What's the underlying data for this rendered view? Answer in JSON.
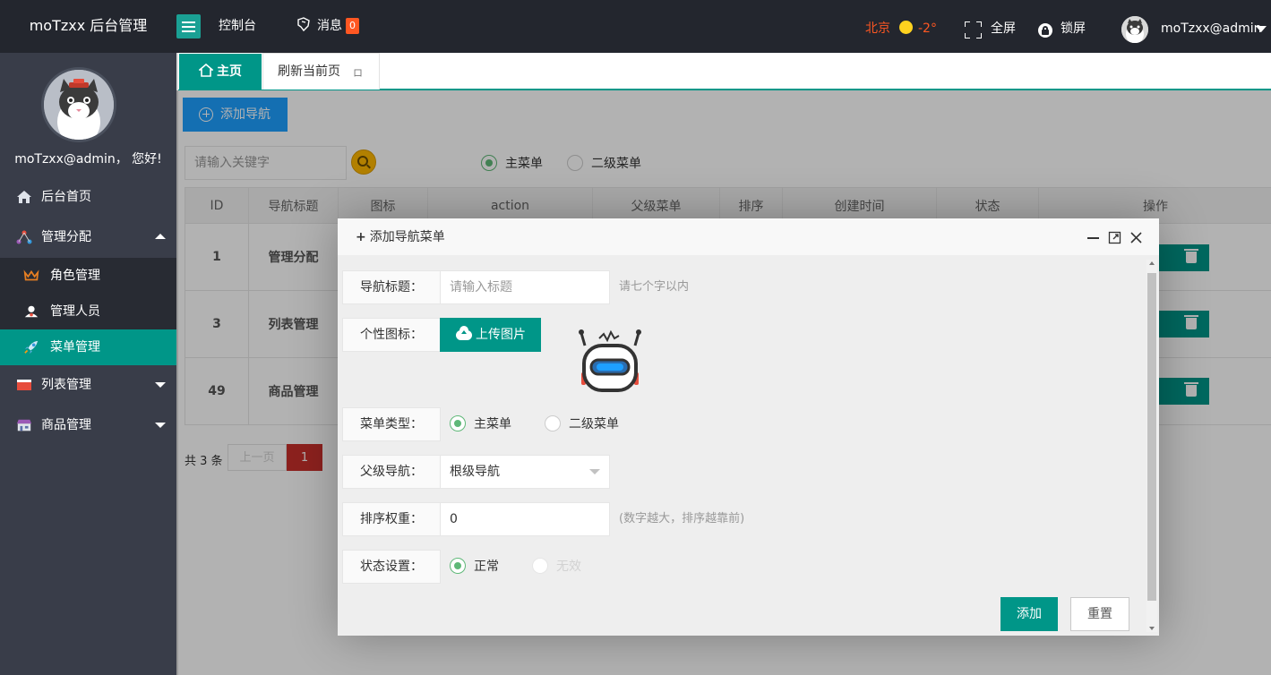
{
  "header": {
    "logo": "moTzxx 后台管理",
    "nav_dashboard": "控制台",
    "nav_messages": "消息",
    "message_count": "0",
    "city": "北京",
    "temperature": "-2°",
    "fullscreen": "全屏",
    "lock": "锁屏",
    "user": "moTzxx@admin"
  },
  "sidebar": {
    "greeting": "moTzxx@admin， 您好!",
    "items": [
      {
        "label": "后台首页"
      },
      {
        "label": "管理分配"
      },
      {
        "label": "角色管理"
      },
      {
        "label": "管理人员"
      },
      {
        "label": "菜单管理"
      },
      {
        "label": "列表管理"
      },
      {
        "label": "商品管理"
      }
    ]
  },
  "tabs": {
    "home": "主页",
    "refresh": "刷新当前页",
    "close": "ロ"
  },
  "toolbar": {
    "add_nav": "添加导航",
    "search_placeholder": "请输入关键字",
    "filter_main": "主菜单",
    "filter_sub": "二级菜单"
  },
  "table": {
    "headers": [
      "ID",
      "导航标题",
      "图标",
      "action",
      "父级菜单",
      "排序",
      "创建时间",
      "状态",
      "操作"
    ],
    "rows": [
      {
        "id": "1",
        "title": "管理分配"
      },
      {
        "id": "3",
        "title": "列表管理"
      },
      {
        "id": "49",
        "title": "商品管理"
      }
    ]
  },
  "pagination": {
    "total": "共 3 条",
    "prev": "上一页",
    "current": "1"
  },
  "modal": {
    "title": "添加导航菜单",
    "nav_title_label": "导航标题：",
    "nav_title_placeholder": "请输入标题",
    "nav_title_hint": "请七个字以内",
    "icon_label": "个性图标：",
    "upload_label": "上传图片",
    "menu_type_label": "菜单类型：",
    "menu_type_main": "主菜单",
    "menu_type_sub": "二级菜单",
    "parent_label": "父级导航：",
    "parent_value": "根级导航",
    "sort_label": "排序权重：",
    "sort_value": "0",
    "sort_hint": "(数字越大，排序越靠前)",
    "status_label": "状态设置：",
    "status_normal": "正常",
    "status_invalid": "无效",
    "submit": "添加",
    "reset": "重置"
  },
  "colors": {
    "header_bg": "#23262e",
    "sidebar_bg": "#393d49",
    "accent": "#009688",
    "blue": "#1e9fff",
    "danger": "#ff5722",
    "weather": "#ff5722"
  }
}
